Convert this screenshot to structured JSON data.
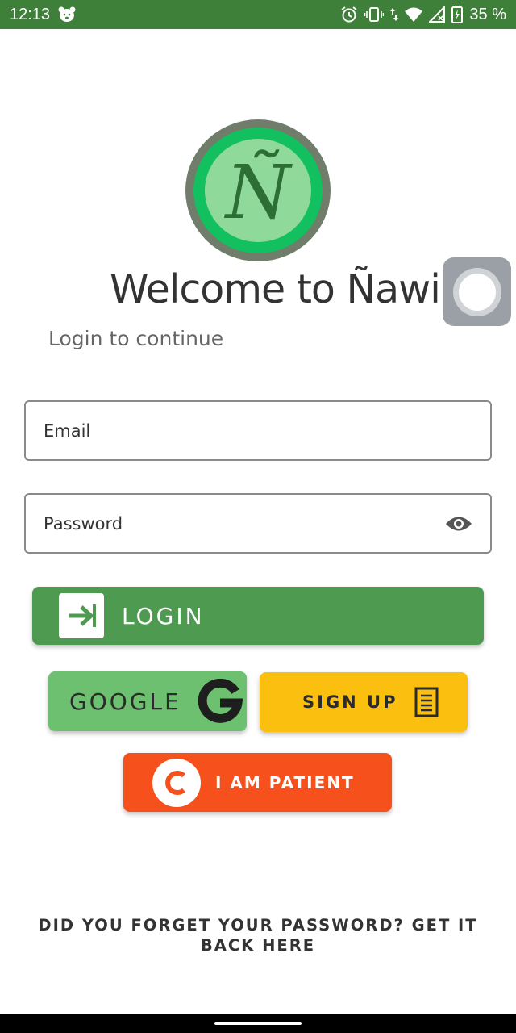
{
  "status_bar": {
    "time": "12:13",
    "battery": "35 %",
    "icons": [
      "bear-notification-icon",
      "alarm-icon",
      "vibrate-icon",
      "data-arrows-icon",
      "wifi-icon",
      "signal-icon",
      "battery-charging-icon"
    ]
  },
  "logo": {
    "letter": "Ñ"
  },
  "header": {
    "title": "Welcome to Ñawi",
    "subtitle": "Login to continue"
  },
  "form": {
    "email_placeholder": "Email",
    "password_placeholder": "Password"
  },
  "buttons": {
    "login": "LOGIN",
    "google": "GOOGLE",
    "sign_up": "SIGN UP",
    "patient": "I AM PATIENT"
  },
  "forgot_password": "DID YOU FORGET YOUR PASSWORD? GET IT BACK HERE",
  "colors": {
    "status_bar": "#3e7f3a",
    "login": "#4f9a51",
    "google": "#6cc070",
    "sign_up": "#fbbf10",
    "patient": "#f6511d"
  }
}
